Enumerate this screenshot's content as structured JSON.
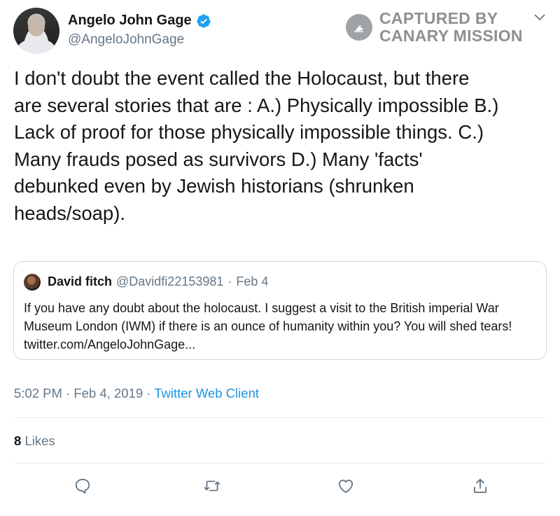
{
  "author": {
    "name": "Angelo John Gage",
    "handle": "@AngeloJohnGage",
    "verified_icon": "verified-badge-icon"
  },
  "watermark": {
    "line1": "CAPTURED BY",
    "line2": "CANARY MISSION"
  },
  "tweet": {
    "text": "I don't doubt the event called the Holocaust, but there\nare several stories that are : A.) Physically impossible B.)\nLack of proof for those physically impossible things. C.)\nMany frauds posed as survivors D.) Many 'facts'\ndebunked even by Jewish historians (shrunken\nheads/soap)."
  },
  "quoted_tweet": {
    "name": "David fitch",
    "handle": "@Davidfi22153981",
    "separator": "·",
    "date": "Feb 4",
    "text": "If you have any doubt about the holocaust. I suggest a visit to the British imperial War Museum London (IWM) if there is an ounce of humanity within you? You will shed tears! twitter.com/AngeloJohnGage..."
  },
  "meta": {
    "time": "5:02 PM",
    "separator": "·",
    "date": "Feb 4, 2019",
    "client": "Twitter Web Client"
  },
  "stats": {
    "likes_count": "8",
    "likes_label": "Likes"
  },
  "actions": [
    "reply-icon",
    "retweet-icon",
    "like-icon",
    "share-icon"
  ],
  "colors": {
    "accent": "#1b95e0",
    "verified": "#1da1f2",
    "secondary_text": "#657786",
    "border": "#ccd6dd"
  }
}
